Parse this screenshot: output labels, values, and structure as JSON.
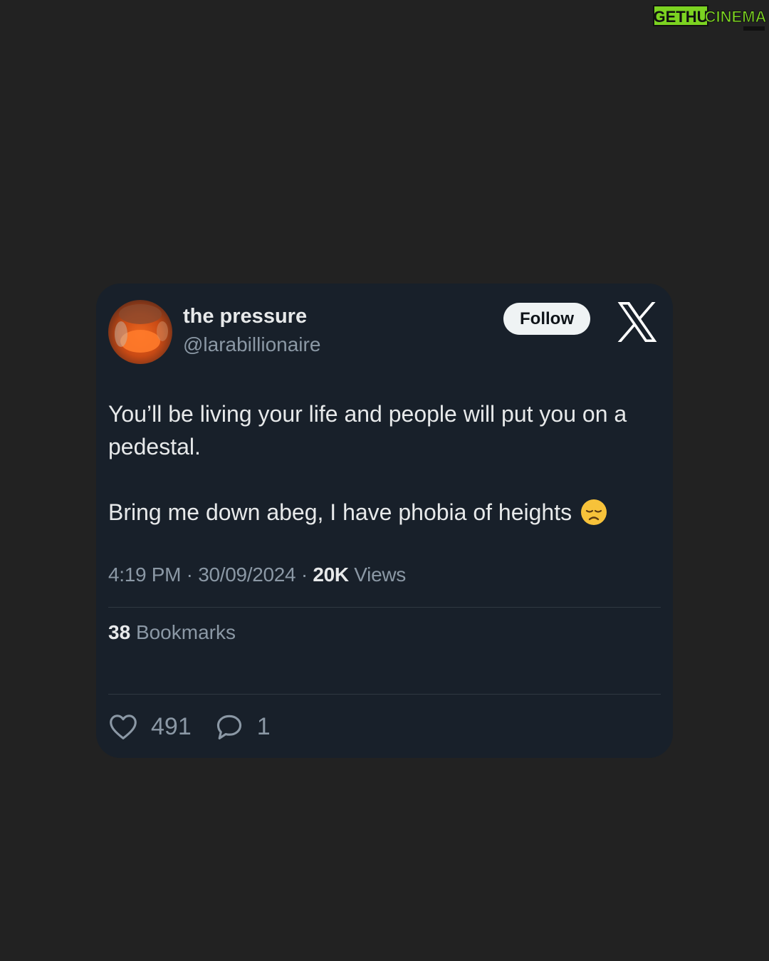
{
  "watermark": {
    "part1": "GETHU",
    "part2": "CINEMA",
    "color1": "#7cd321",
    "color2": "#111111"
  },
  "tweet": {
    "display_name": "the pressure",
    "handle": "@larabillionaire",
    "follow_label": "Follow",
    "text_line1": "You’ll be living your life and people will put you on a pedestal.",
    "text_line2": "Bring me down abeg, I have phobia of heights",
    "emoji": "disappointed-face-icon",
    "time": "4:19 PM",
    "separator": "·",
    "date": "30/09/2024",
    "views_count": "20K",
    "views_label": "Views",
    "bookmarks_count": "38",
    "bookmarks_label": "Bookmarks",
    "likes_count": "491",
    "replies_count": "1"
  },
  "colors": {
    "page_background": "#222222",
    "card_background": "#18202a",
    "primary_text": "#e7e9ea",
    "secondary_text": "#8b98a5",
    "divider": "#2f3841",
    "follow_button": "#eff3f4"
  }
}
